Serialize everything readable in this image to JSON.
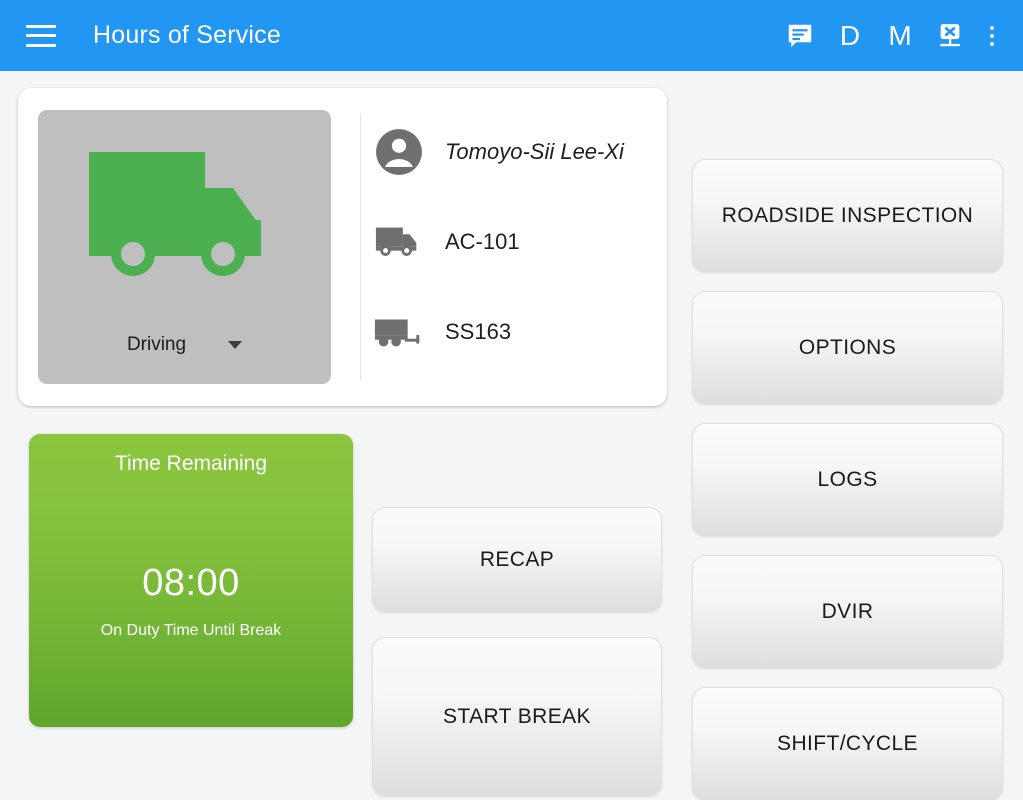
{
  "appbar": {
    "title": "Hours of Service",
    "menu_icon": "hamburger-menu-icon",
    "actions": [
      {
        "name": "messages-icon",
        "label": "",
        "type": "icon"
      },
      {
        "name": "d-indicator",
        "label": "D",
        "type": "letter"
      },
      {
        "name": "m-indicator",
        "label": "M",
        "type": "letter"
      },
      {
        "name": "device-disconnected-icon",
        "label": "",
        "type": "icon"
      },
      {
        "name": "overflow-menu-icon",
        "label": "",
        "type": "icon"
      }
    ]
  },
  "status_card": {
    "duty_status": {
      "label": "Driving",
      "icon": "truck-icon",
      "icon_color": "#4caf50",
      "panel_color": "#bfbfbf"
    },
    "info": [
      {
        "icon": "person-icon",
        "value": "Tomoyo-Sii Lee-Xi"
      },
      {
        "icon": "truck-icon",
        "value": "AC-101"
      },
      {
        "icon": "trailer-icon",
        "value": "SS163"
      }
    ]
  },
  "time_remaining": {
    "title": "Time Remaining",
    "value": "08:00",
    "subtitle": "On Duty Time Until Break",
    "gradient_top": "#8cc63f",
    "gradient_bottom": "#5fa52c"
  },
  "middle_buttons": {
    "recap": "RECAP",
    "start_break": "START BREAK"
  },
  "right_buttons": {
    "roadside_inspection": "ROADSIDE INSPECTION",
    "options": "OPTIONS",
    "logs": "LOGS",
    "dvir": "DVIR",
    "shift_cycle": "SHIFT/CYCLE"
  },
  "colors": {
    "appbar": "#2196f3",
    "background": "#f4f5f6",
    "card": "#ffffff",
    "button": "#ededed",
    "accent_green": "#4caf50"
  }
}
